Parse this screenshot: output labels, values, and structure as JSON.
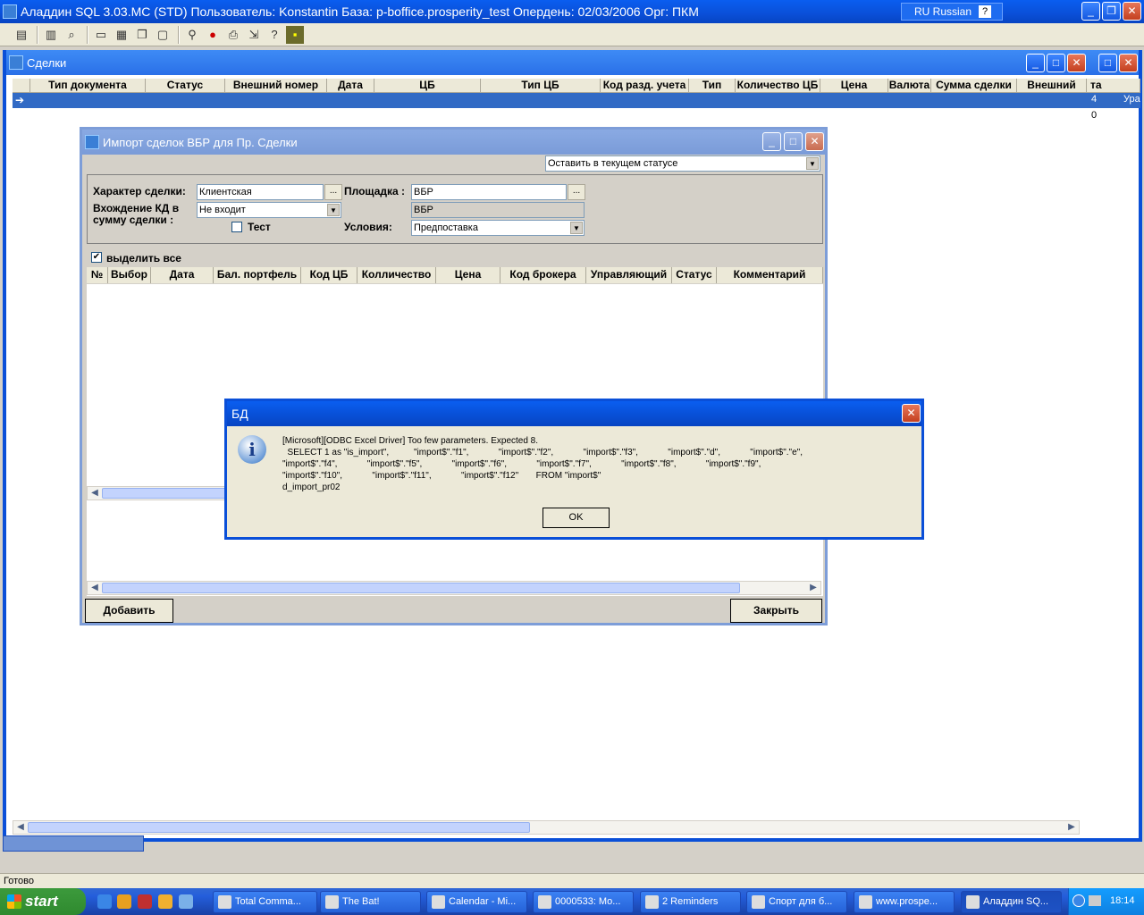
{
  "app": {
    "title": "Аладдин SQL 3.03.MC (STD)  Пользователь: Konstantin База: p-boffice.prosperity_test Опердень: 02/03/2006 Орг: ПКМ",
    "language": "RU Russian"
  },
  "sdelki": {
    "title": "Сделки",
    "columns": [
      "Тип документа",
      "Статус",
      "Внешний номер",
      "Дата",
      "ЦБ",
      "Тип ЦБ",
      "Код разд. учета",
      "Тип",
      "Количество ЦБ",
      "Цена",
      "Валюта",
      "Сумма сделки",
      "Внешний",
      "та"
    ],
    "right_cells": [
      "4",
      "0"
    ],
    "right_text": "Ура"
  },
  "import_dialog": {
    "title": "Импорт сделок ВБР для Пр. Сделки",
    "status_combo": "Оставить в текущем статусе",
    "deal_type_label": "Характер сделки:",
    "deal_type_value": "Клиентская",
    "platform_label": "Площадка :",
    "platform_value": "ВБР",
    "platform_value2": "ВБР",
    "kd_label_line1": "Вхождение КД в",
    "kd_label_line2": "сумму сделки :",
    "kd_value": "Не входит",
    "test_label": "Тест",
    "conditions_label": "Условия:",
    "conditions_value": "Предпоставка",
    "select_all_label": "выделить все",
    "columns": [
      "№",
      "Выбор",
      "Дата",
      "Бал. портфель",
      "Код ЦБ",
      "Колличество",
      "Цена",
      "Код брокера",
      "Управляющий",
      "Статус",
      "Комментарий"
    ],
    "add_button": "Добавить",
    "close_button": "Закрыть"
  },
  "error_dialog": {
    "title": "БД",
    "message_lines": [
      "[Microsoft][ODBC Excel Driver] Too few parameters. Expected 8.",
      "  SELECT 1 as \"is_import\",          \"import$\".\"f1\",            \"import$\".\"f2\",            \"import$\".\"f3\",            \"import$\".\"d\",            \"import$\".\"e\",",
      "\"import$\".\"f4\",            \"import$\".\"f5\",            \"import$\".\"f6\",            \"import$\".\"f7\",            \"import$\".\"f8\",            \"import$\".\"f9\",",
      "\"import$\".\"f10\",            \"import$\".\"f11\",            \"import$\".\"f12\"       FROM \"import$\"",
      "d_import_pr02"
    ],
    "ok_button": "OK"
  },
  "status_bar": {
    "text": "Готово"
  },
  "taskbar": {
    "start_label": "start",
    "buttons": [
      "Total Comma...",
      "The Bat!",
      "Calendar - Mi...",
      "0000533: Mo...",
      "2 Reminders",
      "Спорт для б...",
      "www.prospe...",
      "Аладдин SQ..."
    ],
    "clock": "18:14"
  }
}
